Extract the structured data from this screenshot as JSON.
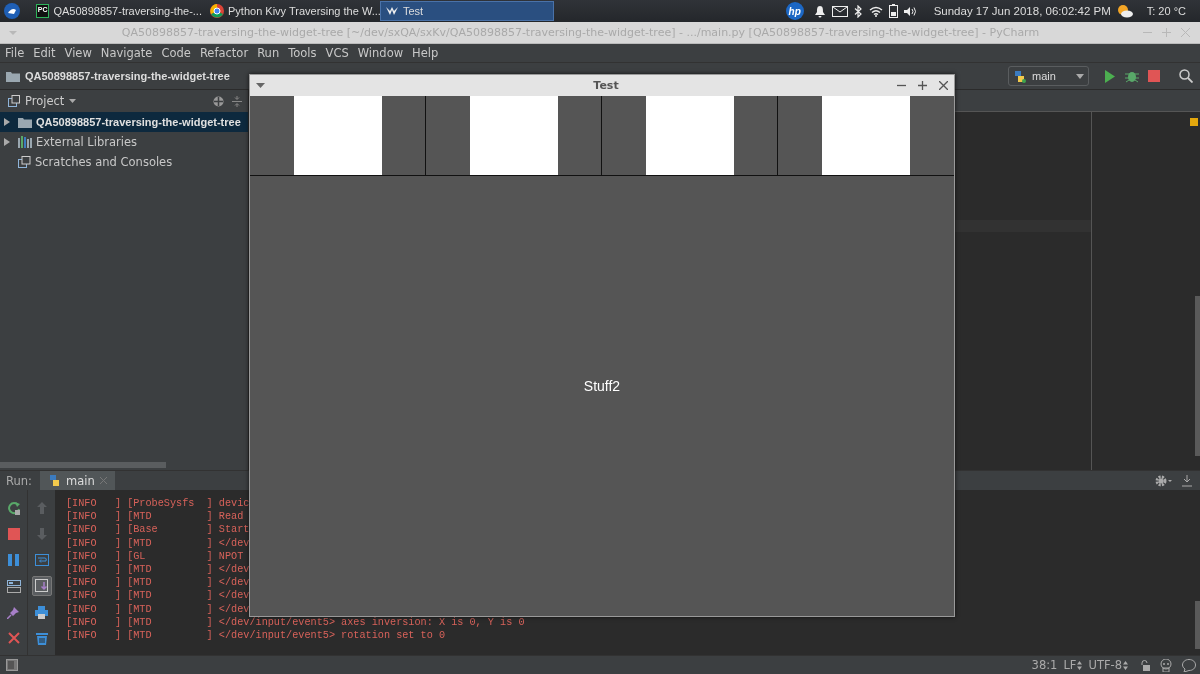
{
  "taskbar": {
    "tasks": [
      {
        "kind": "pycharm",
        "icon_text": "PC",
        "label": "QA50898857-traversing-the-...",
        "selected": false
      },
      {
        "kind": "browser",
        "label": "Python Kivy Traversing the W...",
        "selected": false
      },
      {
        "kind": "kivy",
        "label": "Test",
        "selected": true
      }
    ],
    "tray": {
      "logo": "hp",
      "clock": "Sunday 17 Jun 2018, 06:02:42 PM",
      "temperature": "T: 20 °C"
    }
  },
  "ide_window": {
    "title": "QA50898857-traversing-the-widget-tree [~/dev/sxQA/sxKv/QA50898857-traversing-the-widget-tree] - .../main.py [QA50898857-traversing-the-widget-tree] - PyCharm",
    "menu": [
      "File",
      "Edit",
      "View",
      "Navigate",
      "Code",
      "Refactor",
      "Run",
      "Tools",
      "VCS",
      "Window",
      "Help"
    ],
    "breadcrumb": "QA50898857-traversing-the-widget-tree",
    "run_config": "main",
    "project_panel": {
      "title": "Project",
      "tree": [
        {
          "kind": "project",
          "label": "QA50898857-traversing-the-widget-tree",
          "selected": true,
          "expanded": false
        },
        {
          "kind": "libraries",
          "label": "External Libraries",
          "selected": false,
          "expanded": false
        },
        {
          "kind": "scratches",
          "label": "Scratches and Consoles",
          "selected": false
        }
      ]
    },
    "run_panel": {
      "label": "Run:",
      "tabs": [
        {
          "label": "main",
          "selected": true
        }
      ],
      "scroll_to_end": true,
      "console_lines": [
        "[INFO   ] [ProbeSysfs  ] devic",
        "[INFO   ] [MTD         ] Read",
        "[INFO   ] [Base        ] Start",
        "[INFO   ] [MTD         ] </dev",
        "[INFO   ] [GL          ] NPOT",
        "[INFO   ] [MTD         ] </dev",
        "[INFO   ] [MTD         ] </dev",
        "[INFO   ] [MTD         ] </dev",
        "[INFO   ] [MTD         ] </dev",
        "[INFO   ] [MTD         ] </dev/input/event5> axes inversion: X is 0, Y is 0",
        "[INFO   ] [MTD         ] </dev/input/event5> rotation set to 0"
      ]
    },
    "status_bar": {
      "position": "38:1",
      "line_separator": "LF",
      "encoding": "UTF-8"
    }
  },
  "app_window": {
    "title": "Test",
    "tiles": [
      {
        "kind": "image"
      },
      {
        "kind": "image"
      },
      {
        "kind": "image"
      },
      {
        "kind": "image"
      }
    ],
    "label": "Stuff2"
  }
}
